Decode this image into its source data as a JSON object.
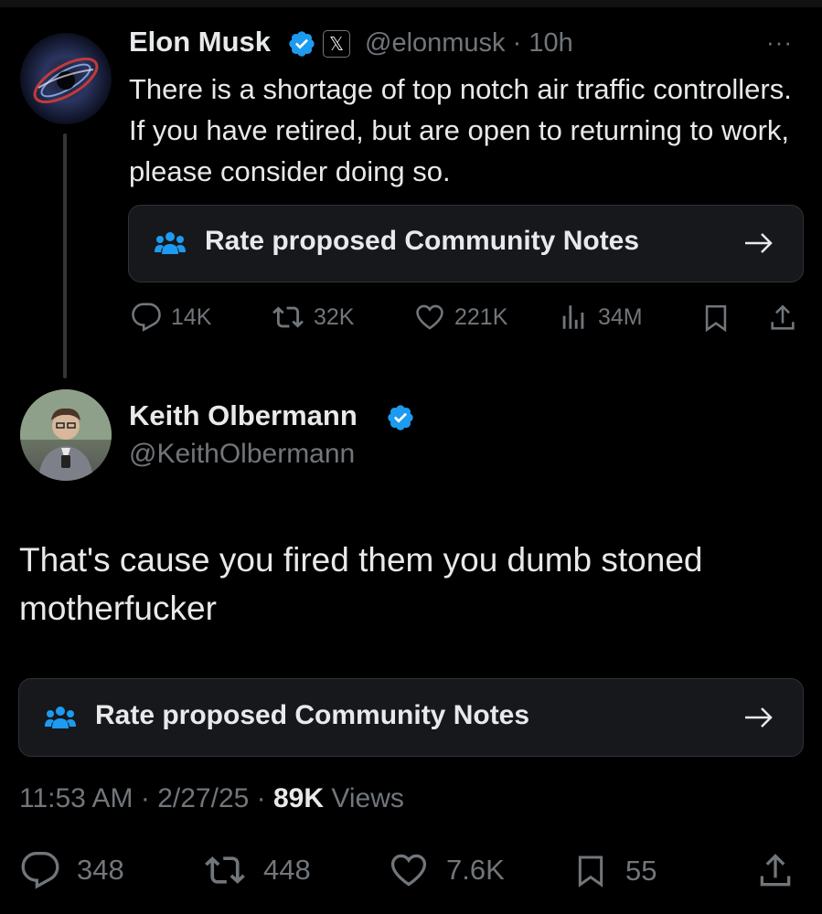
{
  "parent_tweet": {
    "author_name": "Elon Musk",
    "x_badge": "𝕏",
    "handle": "@elonmusk",
    "separator": "·",
    "time_ago": "10h",
    "more": "···",
    "text": "There is a shortage of top notch air traffic controllers. If you have retired, but are open to returning to work, please consider doing so.",
    "community_note_label": "Rate proposed Community Notes",
    "actions": {
      "replies": "14K",
      "reposts": "32K",
      "likes": "221K",
      "views": "34M"
    }
  },
  "reply_tweet": {
    "author_name": "Keith Olbermann",
    "handle": "@KeithOlbermann",
    "text": "That's cause you fired them you dumb stoned motherfucker",
    "community_note_label": "Rate proposed Community Notes",
    "time": "11:53 AM",
    "date": "2/27/25",
    "dot": "·",
    "views_count": "89K",
    "views_label": "Views",
    "actions": {
      "replies": "348",
      "reposts": "448",
      "likes": "7.6K",
      "bookmarks": "55"
    }
  },
  "colors": {
    "background": "#000000",
    "text_primary": "#e7e9ea",
    "text_secondary": "#71767b",
    "verified_blue": "#1d9bf0",
    "note_icon_blue": "#1d9bf0",
    "note_bg": "#16181c"
  },
  "icons": [
    "verified-badge-icon",
    "x-premium-icon",
    "more-icon",
    "community-notes-icon",
    "arrow-right-icon",
    "reply-icon",
    "repost-icon",
    "like-icon",
    "views-icon",
    "bookmark-icon",
    "share-icon"
  ]
}
